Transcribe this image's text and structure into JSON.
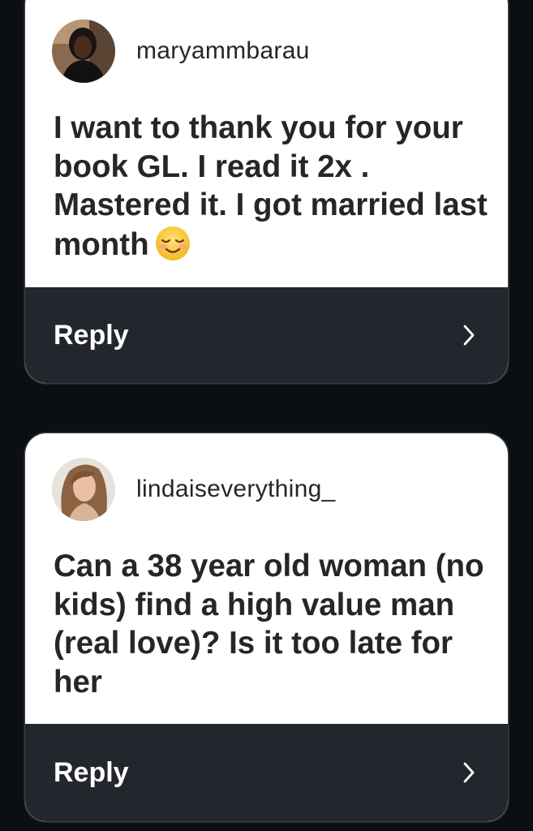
{
  "cards": [
    {
      "username": "maryammbarau",
      "question_text": "I want to thank you for your book GL. I read it 2x . Mastered it. I got married last month",
      "emoji_icon": "smiling-face-icon",
      "reply_label": "Reply",
      "avatar_icon": "user-avatar-photo"
    },
    {
      "username": "lindaiseverything_",
      "question_text": "Can a 38 year old woman (no kids) find a high value man (real love)? Is it too late for her",
      "reply_label": "Reply",
      "avatar_icon": "user-avatar-photo"
    }
  ],
  "colors": {
    "background": "#0b0e13",
    "card": "#ffffff",
    "reply_bar": "#23262d",
    "text": "#262626"
  }
}
